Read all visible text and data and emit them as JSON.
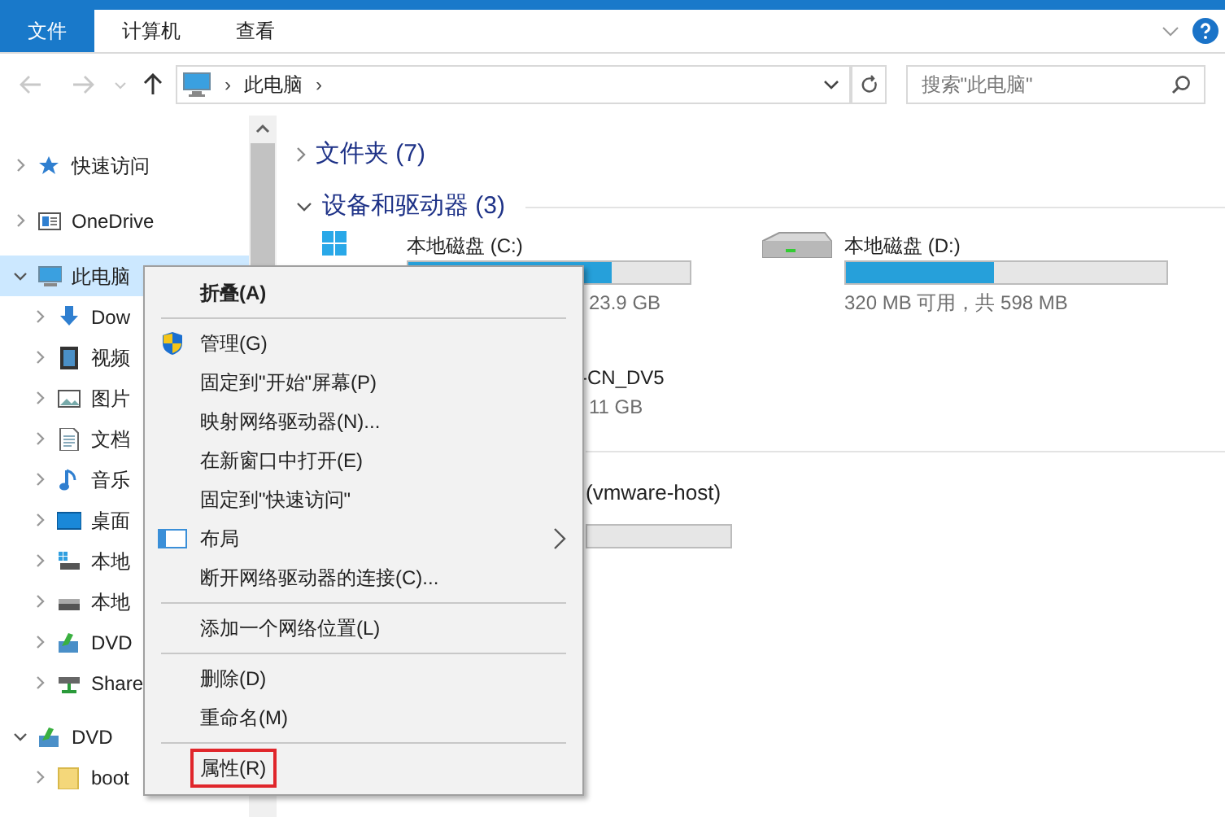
{
  "ribbon": {
    "tabs": [
      {
        "label": "文件",
        "selected": true
      },
      {
        "label": "计算机",
        "selected": false
      },
      {
        "label": "查看",
        "selected": false
      }
    ]
  },
  "address_bar": {
    "path": "此电脑",
    "separator": "›"
  },
  "search": {
    "placeholder": "搜索\"此电脑\""
  },
  "nav_pane": {
    "items": [
      {
        "label": "快速访问",
        "kind": "star",
        "expanded": false,
        "selected": false
      },
      {
        "label": "OneDrive",
        "kind": "cloud",
        "expanded": false,
        "selected": false
      },
      {
        "label": "此电脑",
        "kind": "pc",
        "expanded": true,
        "selected": true,
        "children": [
          {
            "label": "Dow",
            "kind": "download",
            "expanded": false,
            "selected": false
          },
          {
            "label": "视频",
            "kind": "video",
            "expanded": false,
            "selected": false
          },
          {
            "label": "图片",
            "kind": "picture",
            "expanded": false,
            "selected": false
          },
          {
            "label": "文档",
            "kind": "document",
            "expanded": false,
            "selected": false
          },
          {
            "label": "音乐",
            "kind": "music",
            "expanded": false,
            "selected": false
          },
          {
            "label": "桌面",
            "kind": "desktop",
            "expanded": false,
            "selected": false
          },
          {
            "label": "本地",
            "kind": "system",
            "expanded": false,
            "selected": false
          },
          {
            "label": "本地",
            "kind": "drive",
            "expanded": false,
            "selected": false
          },
          {
            "label": "DVD",
            "kind": "dvd",
            "expanded": false,
            "selected": false
          },
          {
            "label": "Share",
            "kind": "network",
            "expanded": false,
            "selected": false
          }
        ]
      },
      {
        "label": "DVD",
        "kind": "dvd",
        "expanded": true,
        "selected": false,
        "children": [
          {
            "label": "boot",
            "kind": "folder",
            "expanded": false,
            "selected": false
          }
        ]
      }
    ]
  },
  "content": {
    "sections": [
      {
        "title": "文件夹 (7)",
        "expanded": false
      },
      {
        "title": "设备和驱动器 (3)",
        "expanded": true
      }
    ],
    "drives": [
      {
        "name": "本地磁盘 (C:)",
        "level": 0.72,
        "size": "23.9 GB"
      },
      {
        "name": "本地磁盘 (D:)",
        "level": 0.46,
        "size": "320 MB 可用，共 598 MB"
      }
    ],
    "dvd": {
      "name": "-CN_DV5",
      "size": "11 GB"
    },
    "network": {
      "name": "(vmware-host)"
    }
  },
  "context_menu": {
    "items": [
      {
        "kind": "plain",
        "label": "折叠(A)",
        "bold": true,
        "submenu": false,
        "highlighted": false
      },
      {
        "kind": "separator"
      },
      {
        "kind": "shield",
        "label": "管理(G)",
        "bold": false,
        "submenu": false,
        "highlighted": false
      },
      {
        "kind": "plain",
        "label": "固定到\"开始\"屏幕(P)",
        "bold": false,
        "submenu": false,
        "highlighted": false
      },
      {
        "kind": "plain",
        "label": "映射网络驱动器(N)...",
        "bold": false,
        "submenu": false,
        "highlighted": false
      },
      {
        "kind": "plain",
        "label": "在新窗口中打开(E)",
        "bold": false,
        "submenu": false,
        "highlighted": false
      },
      {
        "kind": "plain",
        "label": "固定到\"快速访问\"",
        "bold": false,
        "submenu": false,
        "highlighted": false
      },
      {
        "kind": "layout",
        "label": "布局",
        "bold": false,
        "submenu": true,
        "highlighted": false
      },
      {
        "kind": "plain",
        "label": "断开网络驱动器的连接(C)...",
        "bold": false,
        "submenu": false,
        "highlighted": false
      },
      {
        "kind": "separator"
      },
      {
        "kind": "plain",
        "label": "添加一个网络位置(L)",
        "bold": false,
        "submenu": false,
        "highlighted": false
      },
      {
        "kind": "separator"
      },
      {
        "kind": "plain",
        "label": "删除(D)",
        "bold": false,
        "submenu": false,
        "highlighted": false
      },
      {
        "kind": "plain",
        "label": "重命名(M)",
        "bold": false,
        "submenu": false,
        "highlighted": false
      },
      {
        "kind": "separator"
      },
      {
        "kind": "plain",
        "label": "属性(R)",
        "bold": false,
        "submenu": false,
        "highlighted": true
      }
    ]
  }
}
